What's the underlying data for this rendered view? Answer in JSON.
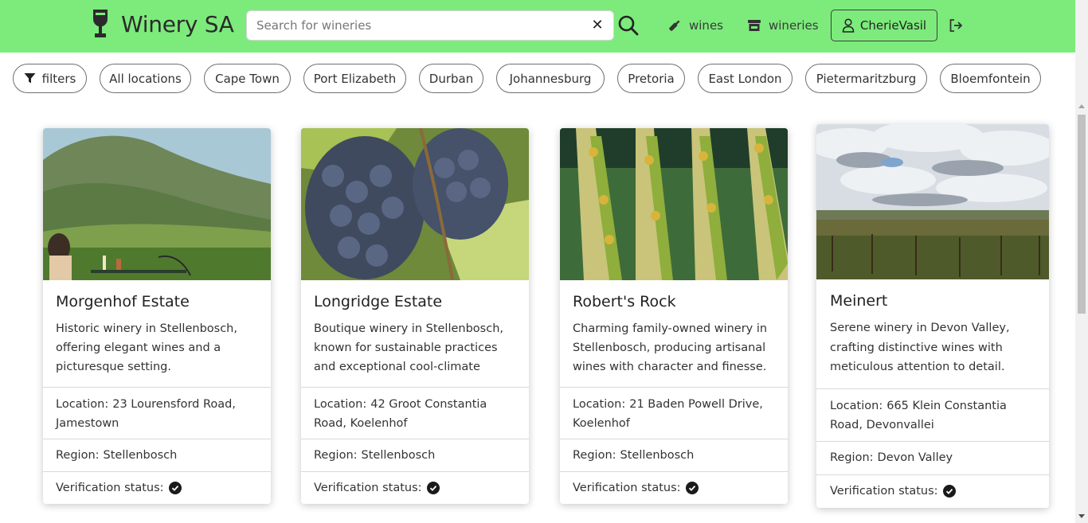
{
  "navbar": {
    "brand": "Winery SA",
    "search_placeholder": "Search for wineries",
    "links": {
      "wines": "wines",
      "wineries": "wineries"
    },
    "username": "CherieVasil",
    "bg_color": "#7ceb7b"
  },
  "filters": {
    "filters_label": "filters",
    "locations": [
      "All locations",
      "Cape Town",
      "Port Elizabeth",
      "Durban",
      "Johannesburg",
      "Pretoria",
      "East London",
      "Pietermaritzburg",
      "Bloemfontein"
    ]
  },
  "labels": {
    "location": "Location:",
    "region": "Region:",
    "verification": "Verification status:"
  },
  "wineries": [
    {
      "name": "Morgenhof Estate",
      "description": "Historic winery in Stellenbosch, offering elegant wines and a picturesque setting.",
      "location": "23 Lourensford Road, Jamestown",
      "region": "Stellenbosch",
      "verified": true,
      "image": "mountain-vineyard-dining"
    },
    {
      "name": "Longridge Estate",
      "description": "Boutique winery in Stellenbosch, known for sustainable practices and exceptional cool-climate",
      "location": "42 Groot Constantia Road, Koelenhof",
      "region": "Stellenbosch",
      "verified": true,
      "image": "grape-bunches"
    },
    {
      "name": "Robert's Rock",
      "description": "Charming family-owned winery in Stellenbosch, producing artisanal wines with character and finesse.",
      "location": "21 Baden Powell Drive, Koelenhof",
      "region": "Stellenbosch",
      "verified": true,
      "image": "vineyard-rows"
    },
    {
      "name": "Meinert",
      "description": "Serene winery in Devon Valley, crafting distinctive wines with meticulous attention to detail.",
      "location": "665 Klein Constantia Road, Devonvallei",
      "region": "Devon Valley",
      "verified": true,
      "image": "cloudy-sky-vineyard"
    }
  ]
}
